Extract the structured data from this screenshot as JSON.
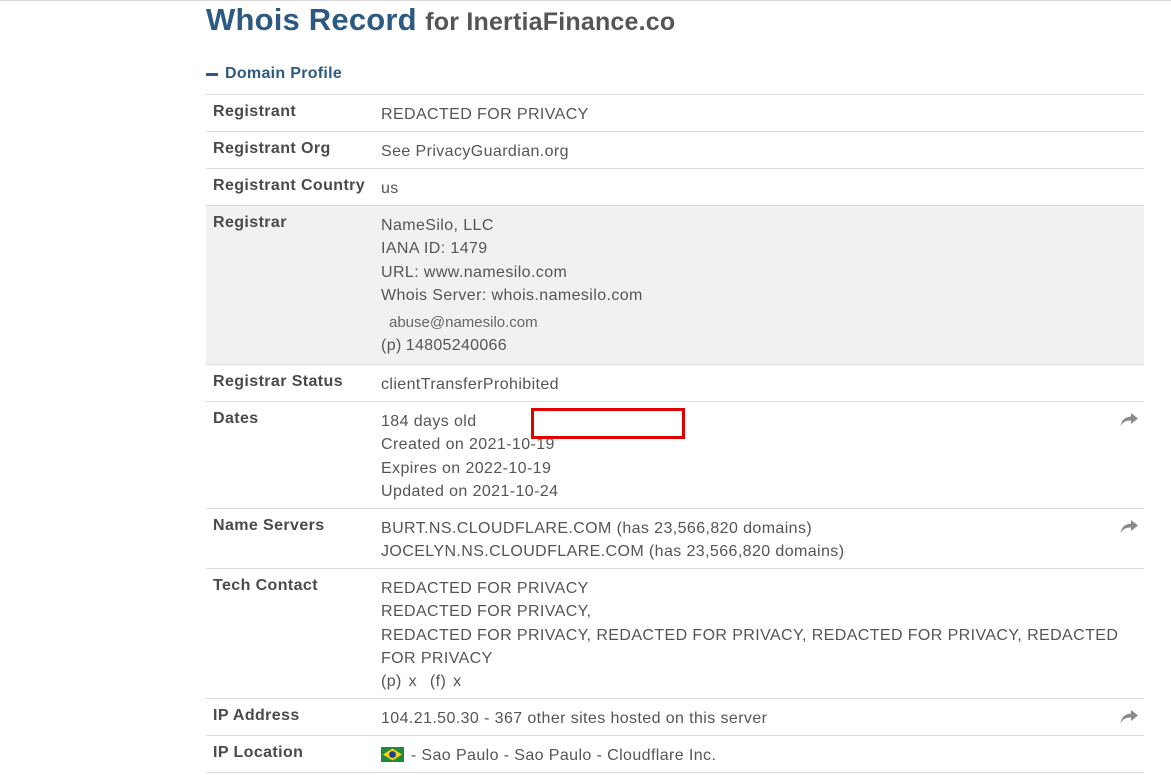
{
  "header": {
    "title_main": "Whois Record",
    "title_for": "for InertiaFinance.co"
  },
  "section": {
    "label": "Domain Profile"
  },
  "rows": {
    "registrant": {
      "label": "Registrant",
      "value": "REDACTED FOR PRIVACY"
    },
    "registrant_org": {
      "label": "Registrant Org",
      "value": "See PrivacyGuardian.org"
    },
    "registrant_country": {
      "label": "Registrant Country",
      "value": "us"
    },
    "registrar": {
      "label": "Registrar",
      "name": "NameSilo, LLC",
      "iana": "IANA ID: 1479",
      "url": "URL: www.namesilo.com",
      "whois_server": "Whois Server: whois.namesilo.com",
      "abuse_email": "abuse@namesilo.com",
      "phone_label": "(p)",
      "phone": "14805240066"
    },
    "registrar_status": {
      "label": "Registrar Status",
      "value": "clientTransferProhibited"
    },
    "dates": {
      "label": "Dates",
      "age": "184 days old",
      "created": "Created on 2021-10-19",
      "expires": "Expires on 2022-10-19",
      "updated": "Updated on 2021-10-24"
    },
    "name_servers": {
      "label": "Name Servers",
      "ns1": "BURT.NS.CLOUDFLARE.COM (has 23,566,820 domains)",
      "ns2": "JOCELYN.NS.CLOUDFLARE.COM (has 23,566,820 domains)"
    },
    "tech_contact": {
      "label": "Tech Contact",
      "line1": "REDACTED FOR PRIVACY",
      "line2": "REDACTED FOR PRIVACY,",
      "line3": "REDACTED FOR PRIVACY, REDACTED FOR PRIVACY, REDACTED FOR PRIVACY, REDACTED FOR PRIVACY",
      "phone_label": "(p)",
      "phone": "x",
      "fax_label": "(f)",
      "fax": "x"
    },
    "ip_address": {
      "label": "IP Address",
      "value": "104.21.50.30 - 367 other sites hosted on this server"
    },
    "ip_location": {
      "label": "IP Location",
      "value": "- Sao Paulo - Sao Paulo - Cloudflare Inc.",
      "flag_icon": "brazil-flag-icon"
    }
  },
  "colors": {
    "title_blue": "#2d5a82",
    "shaded_row": "#f1f1f1",
    "highlight_red": "#e00000",
    "icon_gray": "#8a8a8a"
  },
  "icons": {
    "share": "share-arrow-icon",
    "collapse": "minus-icon"
  }
}
